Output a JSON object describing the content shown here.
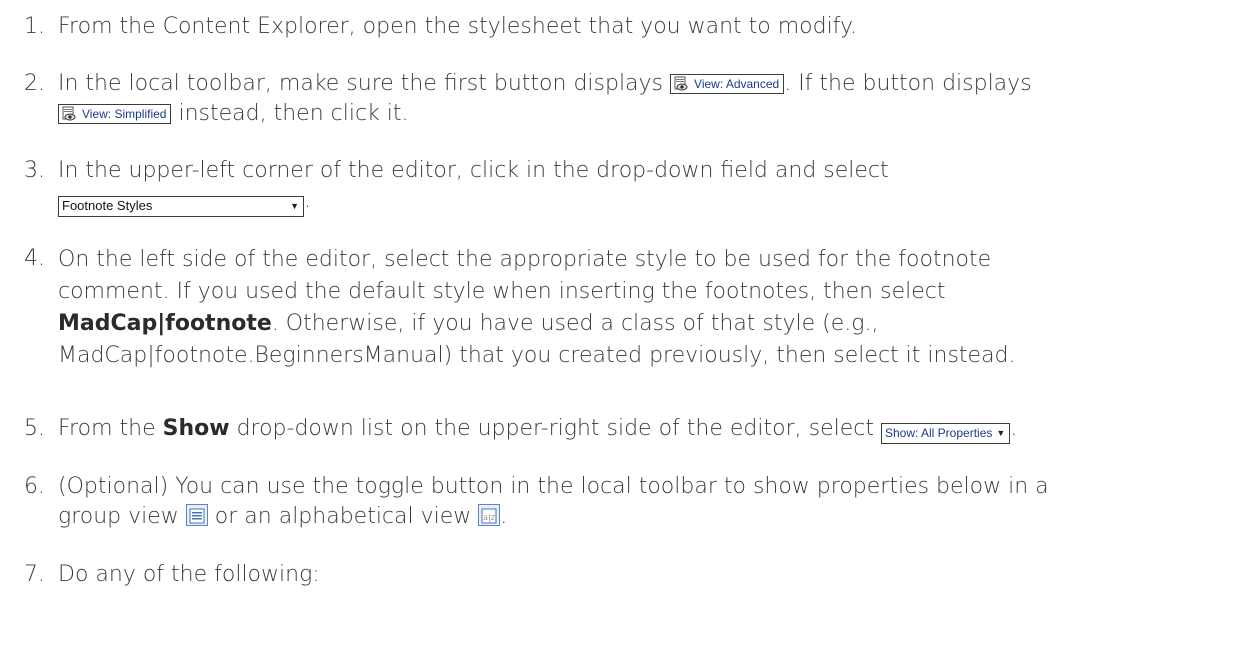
{
  "steps": [
    {
      "num": "1.",
      "lines": [
        "From the Content Explorer, open the stylesheet that you want to modify."
      ]
    },
    {
      "num": "2.",
      "text_a": "In the local toolbar, make sure the first button displays",
      "btn1": "View: Advanced",
      "text_b": ". If the button displays",
      "btn2": "View: Simplified",
      "text_c": "instead, then click it."
    },
    {
      "num": "3.",
      "text_a": "In the upper-left corner of the editor, click in the drop-down field and select",
      "combo": "Footnote Styles",
      "period": "."
    },
    {
      "num": "4.",
      "line1": "On the left side of the editor, select the appropriate style to be used for the footnote",
      "line2": "comment. If you used the default style when inserting the footnotes, then select",
      "bold": "MadCap|footnote",
      "line3b": ". Otherwise, if you have used a class of that style (e.g.,",
      "line4": "MadCap|footnote.BeginnersManual) that you created previously, then select it instead."
    },
    {
      "num": "5.",
      "text_a": "From the",
      "bold": "Show",
      "text_b": "drop-down list on the upper-right side of the editor, select",
      "showbtn": "Show: All Properties",
      "period": "."
    },
    {
      "num": "6.",
      "line1": "(Optional) You can use the toggle button in the local toolbar to show properties below in a",
      "text_a": "group view",
      "text_b": "or an alphabetical view",
      "period": "."
    },
    {
      "num": "7.",
      "lines": [
        "Do any of the following:"
      ]
    }
  ],
  "icons": {
    "view_icon": "monitor-eye-icon",
    "group_icon": "group-view-icon",
    "alpha_icon": "alphabetical-view-icon",
    "dropdown_icon": "chevron-down-icon"
  }
}
